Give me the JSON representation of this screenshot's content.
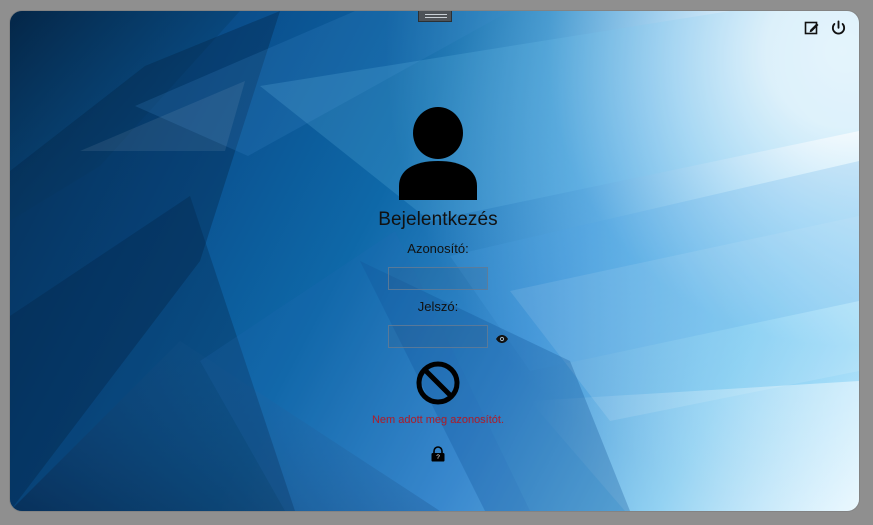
{
  "window": {
    "title": "",
    "accent": "#1a6fb8"
  },
  "toolbar": {
    "actions": [
      {
        "name": "edit",
        "icon": "edit-square-icon"
      },
      {
        "name": "power",
        "icon": "power-icon"
      }
    ]
  },
  "login": {
    "title": "Bejelentkezés",
    "username_label": "Azonosító:",
    "username_value": "",
    "username_placeholder": "",
    "password_label": "Jelszó:",
    "password_value": "",
    "password_placeholder": "",
    "show_password_icon": "eye-icon",
    "status_icon": "blocked-icon",
    "error_message": "Nem adott meg azonosítót.",
    "help_icon": "lock-help-icon"
  },
  "colors": {
    "error": "#b11d2a",
    "icon": "#111111"
  }
}
